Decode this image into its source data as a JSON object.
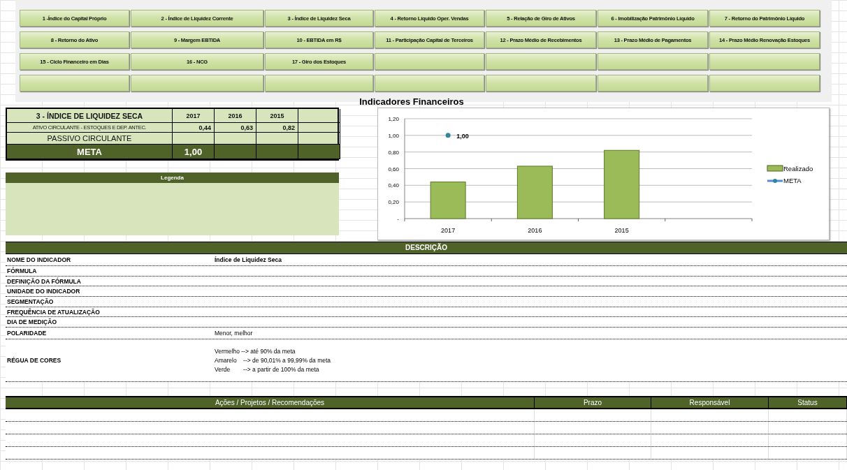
{
  "nav_buttons": [
    {
      "kind": "labeled",
      "label": "1 -Índice do Capital Próprio"
    },
    {
      "kind": "labeled",
      "label": "2 - Índice de Liquidez Corrente"
    },
    {
      "kind": "labeled",
      "label": "3 - Índice de Liquidez Seca"
    },
    {
      "kind": "labeled",
      "label": "4 - Retorno Líquido Oper. Vendas"
    },
    {
      "kind": "labeled",
      "label": "5 - Relação de Giro de Ativos"
    },
    {
      "kind": "labeled",
      "label": "6 - Imobilização Patrimônio Líquido"
    },
    {
      "kind": "labeled",
      "label": "7 - Retorno do Patrimônio Líquido"
    },
    {
      "kind": "labeled",
      "label": "8 - Retorno do Ativo"
    },
    {
      "kind": "labeled",
      "label": "9 - Margem EBTIDA"
    },
    {
      "kind": "labeled",
      "label": "10 - EBTIDA em R$"
    },
    {
      "kind": "labeled",
      "label": "11 - Participação Capital de Terceiros"
    },
    {
      "kind": "labeled",
      "label": "12 - Prazo Médio de Recebimentos"
    },
    {
      "kind": "labeled",
      "label": "13 - Prazo Médio de Pagamentos"
    },
    {
      "kind": "labeled",
      "label": "14 - Prazo Médio Renovação Estoques"
    },
    {
      "kind": "labeled",
      "label": "15 - Ciclo Financeiro em Dias"
    },
    {
      "kind": "labeled",
      "label": "16 - NCG"
    },
    {
      "kind": "labeled",
      "label": "17 - Giro dos Estoques"
    },
    {
      "kind": "blank"
    },
    {
      "kind": "blank"
    },
    {
      "kind": "blank"
    },
    {
      "kind": "blank"
    },
    {
      "kind": "blank"
    },
    {
      "kind": "blank"
    },
    {
      "kind": "blank"
    },
    {
      "kind": "blank"
    },
    {
      "kind": "blank"
    },
    {
      "kind": "blank"
    },
    {
      "kind": "blank"
    }
  ],
  "page_title": "Indicadores Financeiros",
  "summary": {
    "title": "3 - ÍNDICE DE LIQUIDEZ SECA",
    "years": [
      "2017",
      "2016",
      "2015"
    ],
    "numerator": {
      "label": "ATIVO CIRCULANTE - ESTOQUES E DEP. ANTEC.",
      "values": [
        "0,44",
        "0,63",
        "0,82"
      ]
    },
    "denominator": {
      "label": "PASSIVO CIRCULANTE"
    },
    "meta": {
      "label": "META",
      "value": "1,00"
    }
  },
  "legend_panel": {
    "title": "Legenda"
  },
  "chart": {
    "chart_data": {
      "type": "bar",
      "categories": [
        "2017",
        "2016",
        "2015"
      ],
      "series": [
        {
          "name": "Realizado",
          "color": "#9bbb59",
          "values": [
            0.44,
            0.63,
            0.82
          ]
        },
        {
          "name": "META",
          "color": "#31859c",
          "values": [
            1.0,
            null,
            null
          ],
          "type": "line",
          "marker": "circle",
          "value_labels": [
            "1,00",
            null,
            null
          ]
        }
      ],
      "grid": true,
      "legend": "right",
      "ylim": [
        0,
        1.2
      ],
      "yticks": [
        {
          "value": 0,
          "label": "-"
        },
        {
          "value": 0.2,
          "label": "0,20"
        },
        {
          "value": 0.4,
          "label": "0,40"
        },
        {
          "value": 0.6,
          "label": "0,60"
        },
        {
          "value": 0.8,
          "label": "0,80"
        },
        {
          "value": 1.0,
          "label": "1,00"
        },
        {
          "value": 1.2,
          "label": "1,20"
        }
      ]
    }
  },
  "description": {
    "title": "DESCRIÇÃO",
    "rows": [
      {
        "label": "NOME DO INDICADOR",
        "value": "Índice de Liquidez Seca"
      },
      {
        "label": "FÓRMULA"
      },
      {
        "label": "DEFINIÇÃO DA FÓRMULA"
      },
      {
        "label": "UNIDADE DO INDICADOR"
      },
      {
        "label": "SEGMENTAÇÃO"
      },
      {
        "label": "FREQUÊNCIA DE ATUALIZAÇÃO"
      },
      {
        "label": "DIA DE MEDIÇÃO"
      },
      {
        "label": "POLARIDADE",
        "value": "Menor, melhor"
      },
      {
        "label": "RÉGUA DE CORES",
        "lines": [
          "Vermelho --> até 90% da meta",
          "Amarelo    --> de 90,01% a 99,99% da meta",
          "Verde        --> a partir de 100% da meta"
        ]
      }
    ]
  },
  "actions": {
    "columns": [
      "Ações / Projetos / Recomendações",
      "Prazo",
      "Responsável",
      "Status"
    ]
  }
}
